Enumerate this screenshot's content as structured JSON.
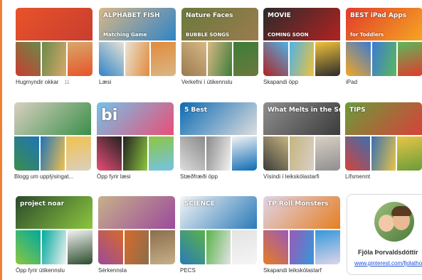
{
  "boards": [
    {
      "title": "Hugmyndir okkar",
      "count": "11",
      "colors": [
        "#e8532a",
        "#c93d2f",
        "#6b8a4a",
        "#d7a96a"
      ]
    },
    {
      "title": "Læsi",
      "overlay1": "ALPHABET FISH",
      "overlay2": "Matching Game",
      "colors": [
        "#d9b785",
        "#2f84c8",
        "#e9e3d4",
        "#e28a3c"
      ]
    },
    {
      "title": "Verkefni í útikennslu",
      "overlay1": "Nature Faces",
      "overlay2": "BUBBLE SONGS",
      "colors": [
        "#6a7a3c",
        "#9b7b4e",
        "#d7b885",
        "#3d7c3a"
      ]
    },
    {
      "title": "Skapandi öpp",
      "overlay1": "MOVIE",
      "overlay2": "COMING SOON",
      "colors": [
        "#2b2b2b",
        "#b22222",
        "#4db3e8",
        "#f0c23b"
      ]
    },
    {
      "title": "iPad",
      "overlay1": "BEST iPad Apps",
      "overlay2": "for Toddlers",
      "colors": [
        "#e23b2b",
        "#f5a623",
        "#3a7bd5",
        "#5cb85c"
      ]
    },
    {
      "title": "Blogg um upplýsingat...",
      "colors": [
        "#d9d0c0",
        "#3a8f4a",
        "#1f73b7",
        "#f2c14e"
      ]
    },
    {
      "title": "Öpp fyrir læsi",
      "overlay1": "bi",
      "colors": [
        "#74c3e9",
        "#e94e77",
        "#222222",
        "#8dc63f"
      ]
    },
    {
      "title": "Stæðfræði öpp",
      "overlay1": "5 Best",
      "colors": [
        "#0b6bb5",
        "#dddddd",
        "#8a8a8a",
        "#f3f3f3"
      ]
    },
    {
      "title": "Vísindi í leikskólastarfi",
      "overlay1": "What Melts in the Sun?",
      "colors": [
        "#8f8f8f",
        "#3b3b3b",
        "#c5b47f",
        "#d9d0c5"
      ]
    },
    {
      "title": "Lífsmennt",
      "overlay1": "TIPS",
      "colors": [
        "#6a9c3a",
        "#d7423a",
        "#3a6fb0",
        "#e8c547"
      ]
    },
    {
      "title": "Öpp fyrir útikennslu",
      "overlay1": "project noar",
      "colors": [
        "#2b4a2b",
        "#8cc63f",
        "#00a99d",
        "#f2f2f2"
      ]
    },
    {
      "title": "Sérkennsla",
      "colors": [
        "#c7b08a",
        "#9b4a9b",
        "#d86a2b",
        "#8a6e4b"
      ]
    },
    {
      "title": "PECS",
      "overlay1": "SCIENCE",
      "colors": [
        "#f5f5f5",
        "#2a7ab8",
        "#59b34a",
        "#e3e3e3"
      ]
    },
    {
      "title": "Skapandi leikskólastarf",
      "overlay1": "TP Roll Monsters",
      "colors": [
        "#dfd5e8",
        "#e67e22",
        "#9b59b6",
        "#3498db"
      ]
    }
  ],
  "profile": {
    "name": "Fjóla Þorvaldsdóttir",
    "url": "www.pinterest.com/fjolathorv"
  }
}
